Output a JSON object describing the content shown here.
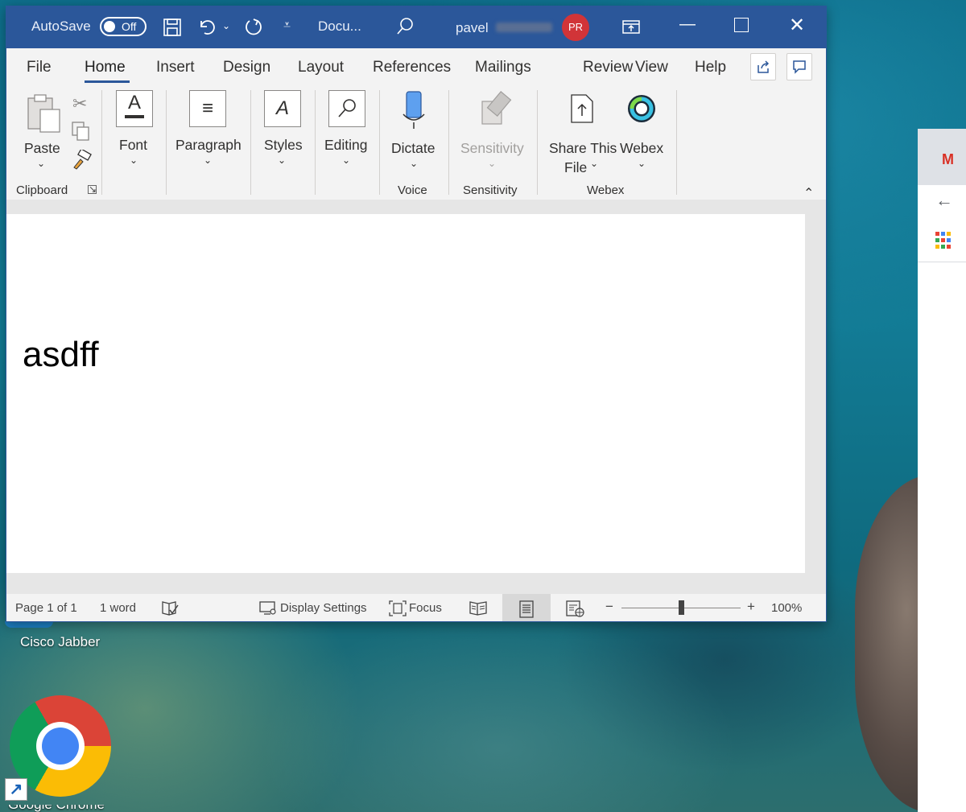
{
  "titlebar": {
    "autosave_label": "AutoSave",
    "autosave_state": "Off",
    "doc_name": "Docu...",
    "user_name": "pavel",
    "avatar_initials": "PR"
  },
  "tabs": [
    "File",
    "Home",
    "Insert",
    "Design",
    "Layout",
    "References",
    "Mailings",
    "Review",
    "View",
    "Help"
  ],
  "active_tab": "Home",
  "ribbon": {
    "paste": "Paste",
    "clipboard_group": "Clipboard",
    "font": "Font",
    "paragraph": "Paragraph",
    "styles": "Styles",
    "editing": "Editing",
    "dictate": "Dictate",
    "voice_group": "Voice",
    "sensitivity_btn": "Sensitivity",
    "sensitivity_group": "Sensitivity",
    "share_line1": "Share This",
    "share_line2": "File",
    "webex_btn": "Webex",
    "webex_group": "Webex"
  },
  "document": {
    "text": "asdff"
  },
  "status": {
    "page": "Page 1 of 1",
    "words": "1 word",
    "display_settings": "Display Settings",
    "focus": "Focus",
    "zoom_minus": "−",
    "zoom_plus": "+",
    "zoom_level": "100%",
    "zoom_value": 100
  },
  "desktop": {
    "jabber_label": "Cisco Jabber",
    "chrome_label": "Google Chrome"
  },
  "colors": {
    "word_blue": "#2b579a",
    "avatar_red": "#d13438"
  }
}
